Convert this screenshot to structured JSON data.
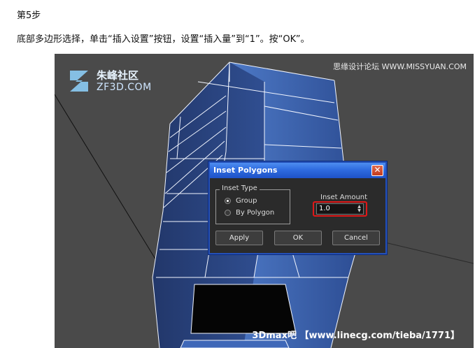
{
  "article": {
    "step_title": "第5步",
    "instruction": "底部多边形选择，单击“插入设置”按钮，设置“插入量”到“1”。按“OK”。"
  },
  "viewport": {
    "logo_cn": "朱峰社区",
    "logo_en": "ZF3D.COM",
    "watermark_top": "思缘设计论坛 WWW.MISSYUAN.COM",
    "watermark_bottom": "3Dmax吧 【www.linecg.com/tieba/1771】",
    "icon_names": [
      "zf3d-logo-icon"
    ]
  },
  "dialog": {
    "title": "Inset Polygons",
    "close_label": "✕",
    "inset_type": {
      "legend": "Inset Type",
      "options": [
        "Group",
        "By Polygon"
      ],
      "selected": "Group"
    },
    "inset_amount": {
      "label": "Inset Amount",
      "value": "1.0"
    },
    "buttons": {
      "apply": "Apply",
      "ok": "OK",
      "cancel": "Cancel"
    }
  },
  "colors": {
    "titlebar": "#2f6be0",
    "highlight": "#e01818",
    "model": "#3f68b8",
    "viewport": "#4a4a4a"
  }
}
